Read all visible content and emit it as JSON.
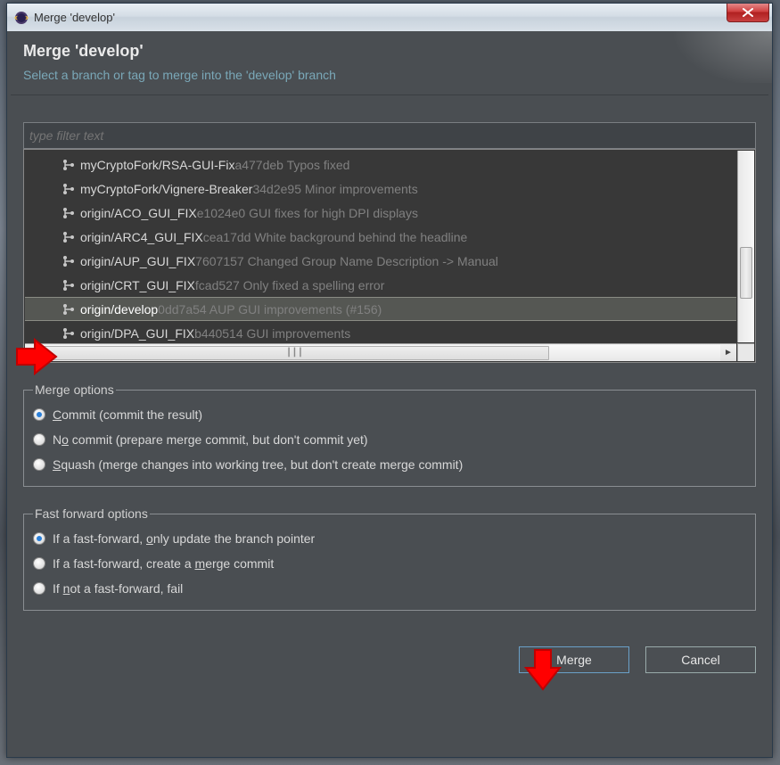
{
  "titlebar": {
    "title": "Merge 'develop'"
  },
  "header": {
    "title": "Merge 'develop'",
    "subtitle": "Select a branch or tag to merge into the 'develop' branch"
  },
  "filter": {
    "placeholder": "type filter text"
  },
  "tree": {
    "items": [
      {
        "name": "myCryptoFork/RSA-GUI-Fix",
        "rest": " a477deb Typos fixed",
        "selected": false
      },
      {
        "name": "myCryptoFork/Vignere-Breaker",
        "rest": " 34d2e95 Minor improvements",
        "selected": false
      },
      {
        "name": "origin/ACO_GUI_FIX",
        "rest": " e1024e0 GUI fixes for high DPI displays",
        "selected": false
      },
      {
        "name": "origin/ARC4_GUI_FIX",
        "rest": " cea17dd White background behind the headline",
        "selected": false
      },
      {
        "name": "origin/AUP_GUI_FIX",
        "rest": " 7607157 Changed Group Name Description -> Manual",
        "selected": false
      },
      {
        "name": "origin/CRT_GUI_FIX",
        "rest": " fcad527 Only fixed a spelling error",
        "selected": false
      },
      {
        "name": "origin/develop",
        "rest": " 0dd7a54 AUP GUI improvements (#156)",
        "selected": true
      },
      {
        "name": "origin/DPA_GUI_FIX",
        "rest": " b440514 GUI improvements",
        "selected": false
      }
    ]
  },
  "merge_options": {
    "legend": "Merge options",
    "options": [
      {
        "label_html": "<u>C</u>ommit (commit the result)",
        "checked": true
      },
      {
        "label_html": "N<u>o</u> commit (prepare merge commit, but don't commit yet)",
        "checked": false
      },
      {
        "label_html": "<u>S</u>quash (merge changes into working tree, but don't create merge commit)",
        "checked": false
      }
    ]
  },
  "ff_options": {
    "legend": "Fast forward options",
    "options": [
      {
        "label_html": "If a fast-forward, <u>o</u>nly update the branch pointer",
        "checked": true
      },
      {
        "label_html": "If a fast-forward, create a <u>m</u>erge commit",
        "checked": false
      },
      {
        "label_html": "If <u>n</u>ot a fast-forward, fail",
        "checked": false
      }
    ]
  },
  "buttons": {
    "merge": "Merge",
    "cancel": "Cancel"
  }
}
